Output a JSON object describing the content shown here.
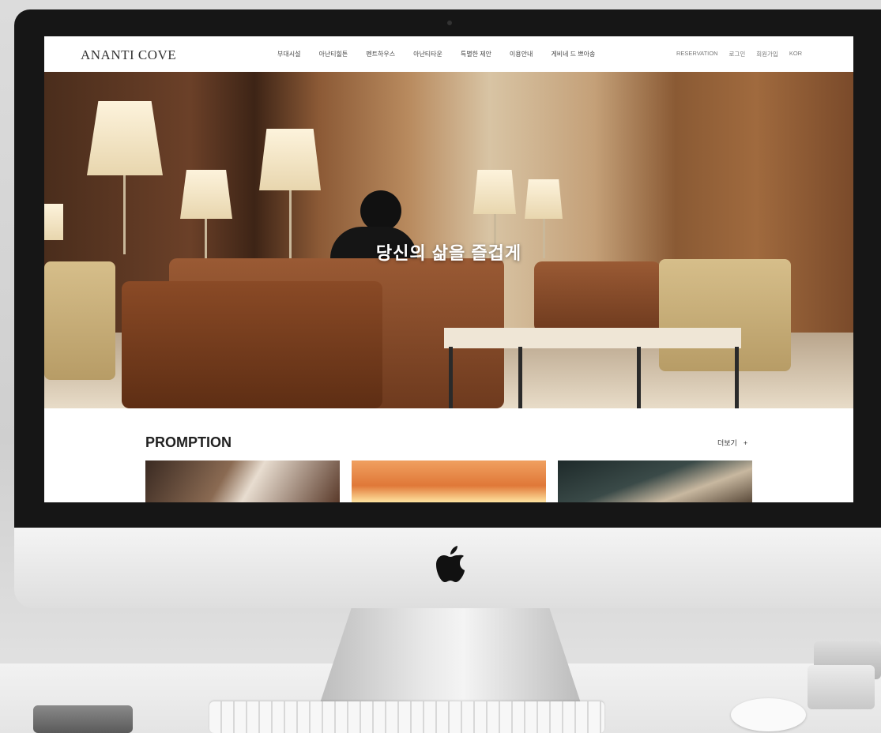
{
  "site": {
    "logo": "ANANTI COVE",
    "nav_items": [
      "부대시설",
      "아난티힐튼",
      "펜트하우스",
      "아난티타운",
      "특별한 제안",
      "이용안내",
      "게비네 드 쁘아송"
    ],
    "right_nav": [
      "RESERVATION",
      "로그인",
      "회원가입",
      "KOR"
    ]
  },
  "hero": {
    "caption": "당신의 삶을 즐겁게"
  },
  "promotion": {
    "title": "PROMPTION",
    "more_label": "더보기",
    "more_icon": "+",
    "cards": [
      {
        "name": "meeting-photo"
      },
      {
        "name": "sunset-photo"
      },
      {
        "name": "pier-photo"
      }
    ]
  },
  "colors": {
    "bezel": "#161616",
    "nav_bg": "#ffffff",
    "hero_text": "#ffffff"
  }
}
